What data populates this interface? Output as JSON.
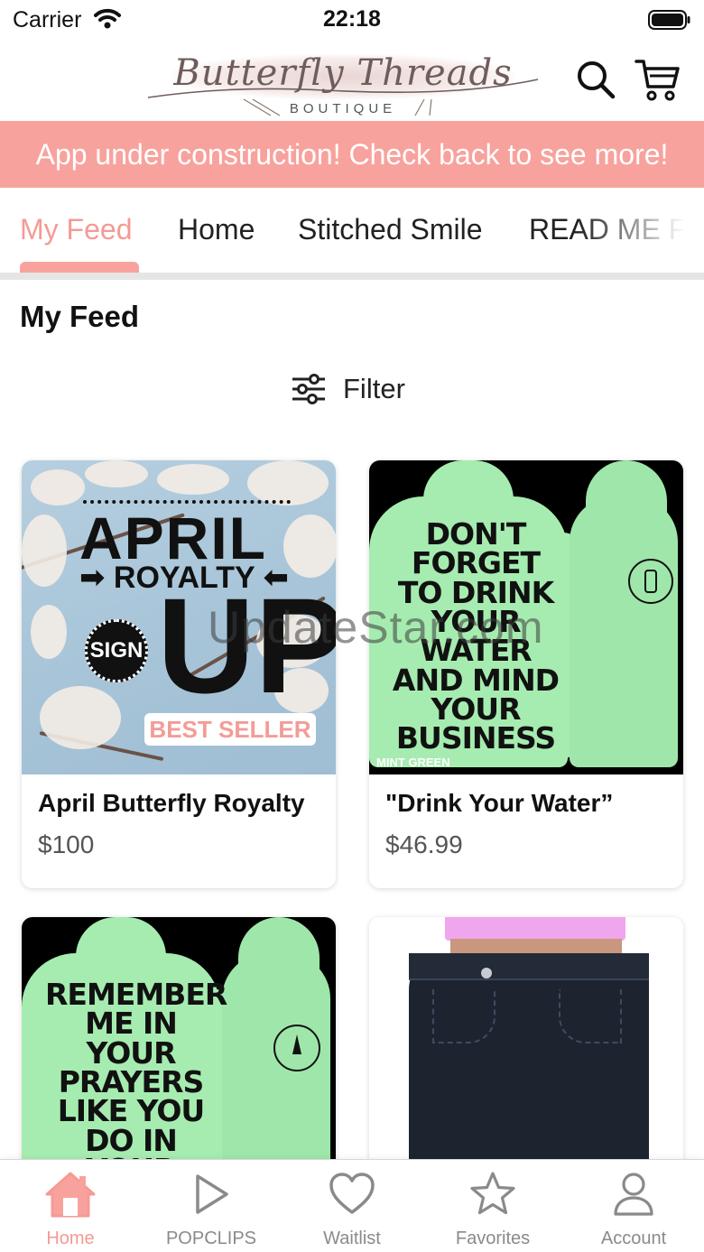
{
  "status_bar": {
    "carrier": "Carrier",
    "time": "22:18"
  },
  "header": {
    "logo_script": "Butterfly Threads",
    "logo_sub": "BOUTIQUE"
  },
  "banner": {
    "text": "App under construction! Check back to see more!"
  },
  "tabs": [
    {
      "label": "My Feed",
      "active": true
    },
    {
      "label": "Home"
    },
    {
      "label": "Stitched Smile"
    },
    {
      "label": "READ ME F"
    }
  ],
  "section": {
    "title": "My Feed",
    "filter_label": "Filter"
  },
  "products": [
    {
      "name": "April Butterfly Royalty",
      "price": "$100",
      "image_text": {
        "title": "APRIL",
        "subtitle": "ROYALTY",
        "big": "UP",
        "badge": "SIGN",
        "ribbon": "BEST SELLER"
      }
    },
    {
      "name": "\"Drink Your Water”",
      "price": "$46.99",
      "image_text": {
        "print": "DON'T FORGET TO DRINK YOUR WATER AND MIND YOUR BUSINESS",
        "tag": "MINT GREEN"
      }
    },
    {
      "name": "",
      "price": "",
      "image_text": {
        "print": "REMEMBER ME IN YOUR PRAYERS LIKE YOU DO IN YOUR GOSSIP"
      }
    },
    {
      "name": "",
      "price": ""
    }
  ],
  "watermark": "UpdateStar.com",
  "bottom_nav": [
    {
      "label": "Home",
      "icon": "home-icon",
      "active": true
    },
    {
      "label": "POPCLIPS",
      "icon": "play-icon"
    },
    {
      "label": "Waitlist",
      "icon": "heart-icon"
    },
    {
      "label": "Favorites",
      "icon": "star-icon"
    },
    {
      "label": "Account",
      "icon": "person-icon"
    }
  ],
  "colors": {
    "accent": "#f8a29d",
    "accent_text": "#f59a95",
    "hoodie": "#a6ecb0"
  }
}
